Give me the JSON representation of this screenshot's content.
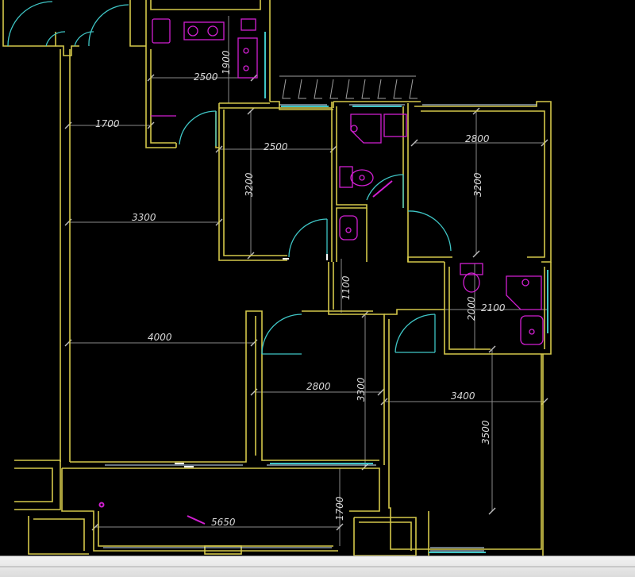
{
  "colors": {
    "background": "#000000",
    "wall": "#d4c84a",
    "fixture": "#d11fd1",
    "door": "#3fc6c6",
    "dimension": "#8a8a8a",
    "window": "#cfe8ff"
  },
  "dimensions": {
    "kitchen_height": "1900",
    "kitchen_width": "2500",
    "corridor_width": "1700",
    "bedroom_ne_width_upper": "2500",
    "bedroom_n_height": "3200",
    "living_width_upper": "3300",
    "bedroom_e_width": "2800",
    "bedroom_e_height": "3200",
    "passage_height": "1100",
    "bath_e_height": "2000",
    "bath_e_width": "2100",
    "living_width_lower": "4000",
    "bedroom_s_width": "2800",
    "bedroom_s_height": "3300",
    "bedroom_se_width": "3400",
    "bedroom_se_height": "3500",
    "balcony_height": "1700",
    "balcony_width": "5650"
  },
  "statusbar": {
    "icon": "status-bar"
  }
}
